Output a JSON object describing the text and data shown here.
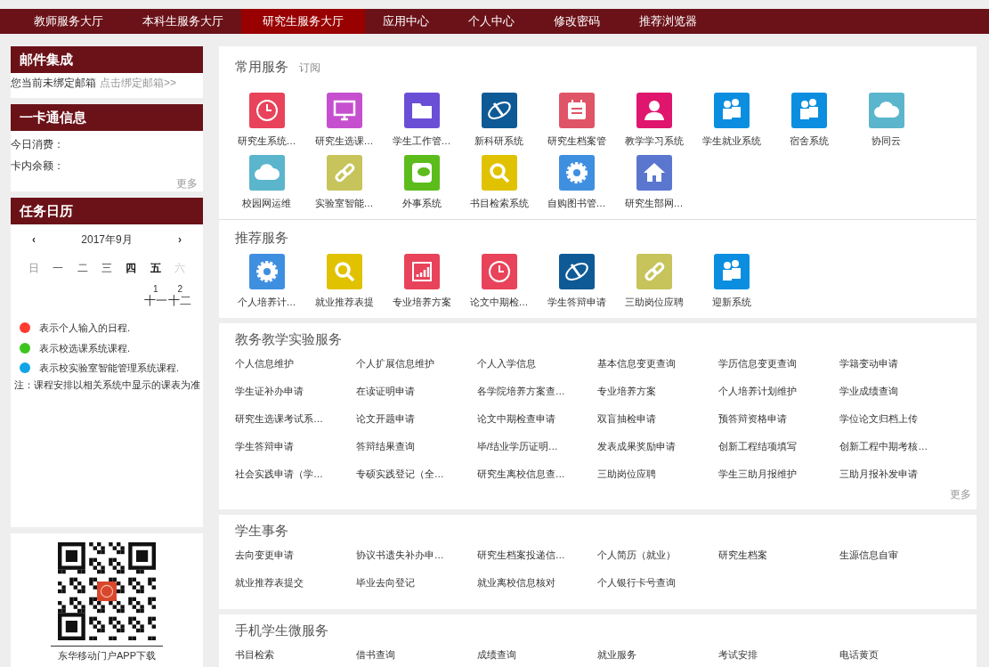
{
  "nav": [
    {
      "label": "教师服务大厅",
      "selected": false
    },
    {
      "label": "本科生服务大厅",
      "selected": false
    },
    {
      "label": "研究生服务大厅",
      "selected": true
    },
    {
      "label": "应用中心",
      "selected": false
    },
    {
      "label": "个人中心",
      "selected": false
    },
    {
      "label": "修改密码",
      "selected": false
    },
    {
      "label": "推荐浏览器",
      "selected": false
    }
  ],
  "sidebar": {
    "mail": {
      "title": "邮件集成",
      "text": "您当前未绑定邮箱",
      "link": "点击绑定邮箱>>"
    },
    "card": {
      "title": "一卡通信息",
      "fields": [
        "今日消费：",
        "卡内余额："
      ],
      "more": "更多"
    },
    "calendar": {
      "title": "任务日历",
      "prev": "‹",
      "month": "2017年9月",
      "next": "›",
      "weekdays": [
        {
          "label": "日",
          "kind": "sunday"
        },
        {
          "label": "一",
          "kind": "weekday"
        },
        {
          "label": "二",
          "kind": "weekday"
        },
        {
          "label": "三",
          "kind": "weekday"
        },
        {
          "label": "四",
          "kind": "bold"
        },
        {
          "label": "五",
          "kind": "bold"
        },
        {
          "label": "六",
          "kind": "saturday"
        }
      ],
      "days": [
        {
          "kind": "blank"
        },
        {
          "kind": "blank"
        },
        {
          "kind": "blank"
        },
        {
          "kind": "blank"
        },
        {
          "kind": "blank"
        },
        {
          "kind": "day",
          "date": "1",
          "lunar": "十一"
        },
        {
          "kind": "day",
          "date": "2",
          "lunar": "十二"
        }
      ],
      "legend": [
        {
          "text": "表示个人输入的日程.",
          "color": "#ff3b30"
        },
        {
          "text": "表示校选课系统课程.",
          "color": "#3cc51f"
        },
        {
          "text": "表示校实验室智能管理系统课程.",
          "color": "#12a5e6"
        }
      ],
      "note": "注：课程安排以相关系统中显示的课表为准"
    },
    "app_download": {
      "caption": "东华移动门户APP下载"
    }
  },
  "common": {
    "title": "常用服务",
    "subscribe": "订阅",
    "apps": [
      {
        "label": "研究生系统…",
        "kind": "clock",
        "color": "#e8435a"
      },
      {
        "label": "研究生选课…",
        "kind": "monitor",
        "color": "#c64fcf"
      },
      {
        "label": "学生工作管…",
        "kind": "folder",
        "color": "#6a4fd6"
      },
      {
        "label": "新科研系统",
        "kind": "globe",
        "color": "#0d5a96"
      },
      {
        "label": "研究生档案管",
        "kind": "notepad",
        "color": "#e05468"
      },
      {
        "label": "教学学习系统",
        "kind": "person",
        "color": "#e0156e"
      },
      {
        "label": "学生就业系统",
        "kind": "people",
        "color": "#0b8ee0"
      },
      {
        "label": "宿舍系统",
        "kind": "people",
        "color": "#0b8ee0"
      },
      {
        "label": "协同云",
        "kind": "cloud",
        "color": "#5bb5cc"
      },
      {
        "label": "校园网运维",
        "kind": "cloud",
        "color": "#5bb5cc"
      },
      {
        "label": "实验室智能…",
        "kind": "link",
        "color": "#c6c45a"
      },
      {
        "label": "外事系统",
        "kind": "chat",
        "color": "#5cbc1c"
      },
      {
        "label": "书目检索系统",
        "kind": "search",
        "color": "#e1c200"
      },
      {
        "label": "自购图书管…",
        "kind": "gear",
        "color": "#3f8fe0"
      },
      {
        "label": "研究生部网…",
        "kind": "house",
        "color": "#5a76cf"
      }
    ]
  },
  "recommended": {
    "title": "推荐服务",
    "apps": [
      {
        "label": "个人培养计…",
        "kind": "gear",
        "color": "#3f8fe0"
      },
      {
        "label": "就业推荐表提",
        "kind": "search",
        "color": "#e1c200"
      },
      {
        "label": "专业培养方案",
        "kind": "chart",
        "color": "#e8435a"
      },
      {
        "label": "论文中期检…",
        "kind": "clock",
        "color": "#e8435a"
      },
      {
        "label": "学生答辩申请",
        "kind": "globe",
        "color": "#0d5a96"
      },
      {
        "label": "三助岗位应聘",
        "kind": "link",
        "color": "#c6c45a"
      },
      {
        "label": "迎新系统",
        "kind": "people",
        "color": "#0b8ee0"
      }
    ]
  },
  "sections": [
    {
      "title": "教务教学实验服务",
      "more": "更多",
      "links": [
        "个人信息维护",
        "个人扩展信息维护",
        "个人入学信息",
        "基本信息变更查询",
        "学历信息变更查询",
        "学籍变动申请",
        "学生证补办申请",
        "在读证明申请",
        "各学院培养方案查…",
        "专业培养方案",
        "个人培养计划维护",
        "学业成绩查询",
        "研究生选课考试系…",
        "论文开题申请",
        "论文中期检查申请",
        "双盲抽检申请",
        "预答辩资格申请",
        "学位论文归档上传",
        "学生答辩申请",
        "答辩结果查询",
        "毕/结业学历证明…",
        "发表成果奖励申请",
        "创新工程结项填写",
        "创新工程中期考核…",
        "社会实践申请（学…",
        "专硕实践登记（全…",
        "研究生离校信息查…",
        "三助岗位应聘",
        "学生三助月报维护",
        "三助月报补发申请"
      ]
    },
    {
      "title": "学生事务",
      "links": [
        "去向变更申请",
        "协议书遗失补办申…",
        "研究生档案投递信…",
        "个人简历（就业）",
        "研究生档案",
        "生源信息自审",
        "就业推荐表提交",
        "毕业去向登记",
        "就业离校信息核对",
        "个人银行卡号查询"
      ]
    },
    {
      "title": "手机学生微服务",
      "links": [
        "书目检索",
        "借书查询",
        "成绩查询",
        "就业服务",
        "考试安排",
        "电话黄页"
      ]
    }
  ]
}
